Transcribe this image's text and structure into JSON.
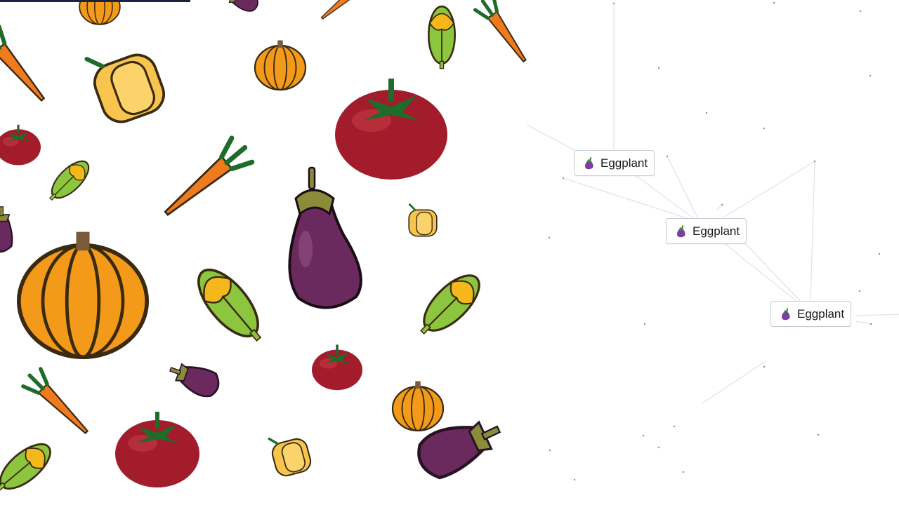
{
  "game": {
    "elements": [
      {
        "id": "e1",
        "emoji": "eggplant-icon",
        "label": "Eggplant"
      },
      {
        "id": "e2",
        "emoji": "eggplant-icon",
        "label": "Eggplant"
      },
      {
        "id": "e3",
        "emoji": "eggplant-icon",
        "label": "Eggplant"
      }
    ]
  },
  "colors": {
    "eggplant": "#6b2a5e",
    "carrot": "#f07a1e",
    "pumpkin": "#f5a623",
    "tomato": "#a21c2b",
    "pepper": "#f7c54e",
    "corn_husk": "#8cc63f"
  }
}
